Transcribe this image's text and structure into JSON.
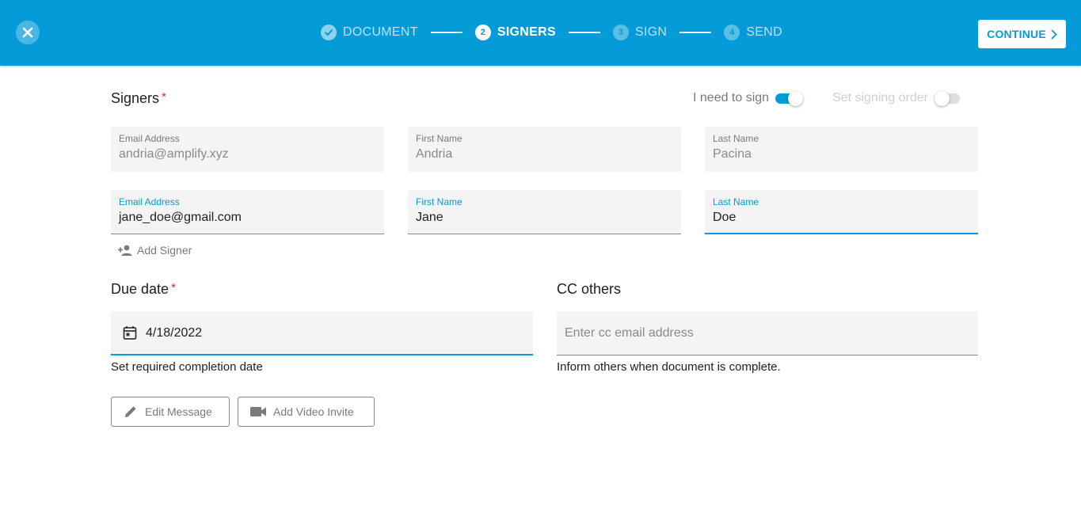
{
  "theme": {
    "accent": "#049bd8",
    "required": "#d32f2f"
  },
  "header": {
    "close_icon": "close-icon",
    "steps": [
      {
        "number": "1",
        "label": "DOCUMENT",
        "state": "done",
        "icon": "check-icon"
      },
      {
        "number": "2",
        "label": "SIGNERS",
        "state": "active"
      },
      {
        "number": "3",
        "label": "SIGN",
        "state": "future"
      },
      {
        "number": "4",
        "label": "SEND",
        "state": "future"
      }
    ],
    "continue_label": "CONTINUE",
    "continue_icon": "chevron-right-icon"
  },
  "signers": {
    "title": "Signers",
    "required_mark": "*",
    "i_need_to_sign": {
      "label": "I need to sign",
      "on": true
    },
    "signing_order": {
      "label": "Set signing order",
      "on": false
    },
    "rows": [
      {
        "email": {
          "label": "Email Address",
          "value": "andria@amplify.xyz"
        },
        "first": {
          "label": "First Name",
          "value": "Andria"
        },
        "last": {
          "label": "Last Name",
          "value": "Pacina"
        }
      },
      {
        "email": {
          "label": "Email Address",
          "value": "jane_doe@gmail.com"
        },
        "first": {
          "label": "First Name",
          "value": "Jane"
        },
        "last": {
          "label": "Last Name",
          "value": "Doe"
        }
      }
    ],
    "add_signer_label": "Add Signer",
    "add_signer_icon": "add-person-icon"
  },
  "due_date": {
    "title": "Due date",
    "required_mark": "*",
    "value": "4/18/2022",
    "icon": "calendar-icon",
    "helper": "Set required completion date"
  },
  "cc": {
    "title": "CC others",
    "placeholder": "Enter cc email address",
    "helper": "Inform others when document is complete."
  },
  "actions": {
    "edit_message": {
      "label": "Edit Message",
      "icon": "pencil-icon"
    },
    "add_video_invite": {
      "label": "Add Video Invite",
      "icon": "video-camera-icon"
    }
  }
}
